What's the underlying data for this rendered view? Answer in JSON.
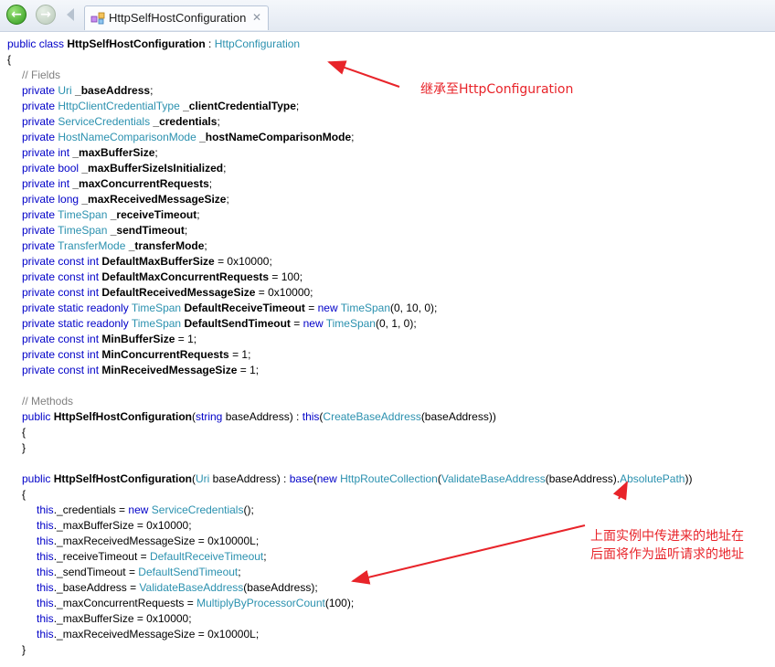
{
  "tab": {
    "title": "HttpSelfHostConfiguration",
    "close_glyph": "✕",
    "icon": "class-icon"
  },
  "nav": {
    "back_icon": "back-arrow-icon",
    "forward_icon": "forward-arrow-icon"
  },
  "code_lines": [
    {
      "indent": 0,
      "parts": [
        [
          "kw",
          "public class "
        ],
        [
          "b",
          "HttpSelfHostConfiguration"
        ],
        [
          "",
          " : "
        ],
        [
          "tp",
          "HttpConfiguration"
        ]
      ]
    },
    {
      "indent": 0,
      "parts": [
        [
          "",
          "{"
        ]
      ]
    },
    {
      "indent": 1,
      "parts": [
        [
          "cm",
          "// Fields"
        ]
      ]
    },
    {
      "indent": 1,
      "parts": [
        [
          "kw",
          "private "
        ],
        [
          "tp",
          "Uri "
        ],
        [
          "b",
          "_baseAddress"
        ],
        [
          "",
          ";"
        ]
      ]
    },
    {
      "indent": 1,
      "parts": [
        [
          "kw",
          "private "
        ],
        [
          "tp",
          "HttpClientCredentialType "
        ],
        [
          "b",
          "_clientCredentialType"
        ],
        [
          "",
          ";"
        ]
      ]
    },
    {
      "indent": 1,
      "parts": [
        [
          "kw",
          "private "
        ],
        [
          "tp",
          "ServiceCredentials "
        ],
        [
          "b",
          "_credentials"
        ],
        [
          "",
          ";"
        ]
      ]
    },
    {
      "indent": 1,
      "parts": [
        [
          "kw",
          "private "
        ],
        [
          "tp",
          "HostNameComparisonMode "
        ],
        [
          "b",
          "_hostNameComparisonMode"
        ],
        [
          "",
          ";"
        ]
      ]
    },
    {
      "indent": 1,
      "parts": [
        [
          "kw",
          "private int "
        ],
        [
          "b",
          "_maxBufferSize"
        ],
        [
          "",
          ";"
        ]
      ]
    },
    {
      "indent": 1,
      "parts": [
        [
          "kw",
          "private bool "
        ],
        [
          "b",
          "_maxBufferSizeIsInitialized"
        ],
        [
          "",
          ";"
        ]
      ]
    },
    {
      "indent": 1,
      "parts": [
        [
          "kw",
          "private int "
        ],
        [
          "b",
          "_maxConcurrentRequests"
        ],
        [
          "",
          ";"
        ]
      ]
    },
    {
      "indent": 1,
      "parts": [
        [
          "kw",
          "private long "
        ],
        [
          "b",
          "_maxReceivedMessageSize"
        ],
        [
          "",
          ";"
        ]
      ]
    },
    {
      "indent": 1,
      "parts": [
        [
          "kw",
          "private "
        ],
        [
          "tp",
          "TimeSpan "
        ],
        [
          "b",
          "_receiveTimeout"
        ],
        [
          "",
          ";"
        ]
      ]
    },
    {
      "indent": 1,
      "parts": [
        [
          "kw",
          "private "
        ],
        [
          "tp",
          "TimeSpan "
        ],
        [
          "b",
          "_sendTimeout"
        ],
        [
          "",
          ";"
        ]
      ]
    },
    {
      "indent": 1,
      "parts": [
        [
          "kw",
          "private "
        ],
        [
          "tp",
          "TransferMode "
        ],
        [
          "b",
          "_transferMode"
        ],
        [
          "",
          ";"
        ]
      ]
    },
    {
      "indent": 1,
      "parts": [
        [
          "kw",
          "private const int "
        ],
        [
          "b",
          "DefaultMaxBufferSize"
        ],
        [
          "",
          " = 0x10000;"
        ]
      ]
    },
    {
      "indent": 1,
      "parts": [
        [
          "kw",
          "private const int "
        ],
        [
          "b",
          "DefaultMaxConcurrentRequests"
        ],
        [
          "",
          " = 100;"
        ]
      ]
    },
    {
      "indent": 1,
      "parts": [
        [
          "kw",
          "private const int "
        ],
        [
          "b",
          "DefaultReceivedMessageSize"
        ],
        [
          "",
          " = 0x10000;"
        ]
      ]
    },
    {
      "indent": 1,
      "parts": [
        [
          "kw",
          "private static readonly "
        ],
        [
          "tp",
          "TimeSpan "
        ],
        [
          "b",
          "DefaultReceiveTimeout"
        ],
        [
          "",
          " = "
        ],
        [
          "kw",
          "new "
        ],
        [
          "tp",
          "TimeSpan"
        ],
        [
          "",
          "(0, 10, 0);"
        ]
      ]
    },
    {
      "indent": 1,
      "parts": [
        [
          "kw",
          "private static readonly "
        ],
        [
          "tp",
          "TimeSpan "
        ],
        [
          "b",
          "DefaultSendTimeout"
        ],
        [
          "",
          " = "
        ],
        [
          "kw",
          "new "
        ],
        [
          "tp",
          "TimeSpan"
        ],
        [
          "",
          "(0, 1, 0);"
        ]
      ]
    },
    {
      "indent": 1,
      "parts": [
        [
          "kw",
          "private const int "
        ],
        [
          "b",
          "MinBufferSize"
        ],
        [
          "",
          " = 1;"
        ]
      ]
    },
    {
      "indent": 1,
      "parts": [
        [
          "kw",
          "private const int "
        ],
        [
          "b",
          "MinConcurrentRequests"
        ],
        [
          "",
          " = 1;"
        ]
      ]
    },
    {
      "indent": 1,
      "parts": [
        [
          "kw",
          "private const int "
        ],
        [
          "b",
          "MinReceivedMessageSize"
        ],
        [
          "",
          " = 1;"
        ]
      ]
    },
    {
      "indent": 1,
      "parts": []
    },
    {
      "indent": 1,
      "parts": [
        [
          "cm",
          "// Methods"
        ]
      ]
    },
    {
      "indent": 1,
      "parts": [
        [
          "kw",
          "public "
        ],
        [
          "b",
          "HttpSelfHostConfiguration"
        ],
        [
          "",
          "("
        ],
        [
          "kw",
          "string "
        ],
        [
          "",
          "baseAddress) : "
        ],
        [
          "kw",
          "this"
        ],
        [
          "",
          "("
        ],
        [
          "tp",
          "CreateBaseAddress"
        ],
        [
          "",
          "(baseAddress))"
        ]
      ]
    },
    {
      "indent": 1,
      "parts": [
        [
          "",
          "{"
        ]
      ]
    },
    {
      "indent": 1,
      "parts": [
        [
          "",
          "}"
        ]
      ]
    },
    {
      "indent": 1,
      "parts": []
    },
    {
      "indent": 1,
      "parts": [
        [
          "kw",
          "public "
        ],
        [
          "b",
          "HttpSelfHostConfiguration"
        ],
        [
          "",
          "("
        ],
        [
          "tp",
          "Uri "
        ],
        [
          "",
          "baseAddress) : "
        ],
        [
          "kw",
          "base"
        ],
        [
          "",
          "("
        ],
        [
          "kw",
          "new "
        ],
        [
          "tp",
          "HttpRouteCollection"
        ],
        [
          "",
          "("
        ],
        [
          "tp",
          "ValidateBaseAddress"
        ],
        [
          "",
          "(baseAddress)."
        ],
        [
          "tp",
          "AbsolutePath"
        ],
        [
          "",
          "))"
        ]
      ]
    },
    {
      "indent": 1,
      "parts": [
        [
          "",
          "{"
        ]
      ]
    },
    {
      "indent": 2,
      "parts": [
        [
          "kw",
          "this"
        ],
        [
          "",
          "._credentials = "
        ],
        [
          "kw",
          "new "
        ],
        [
          "tp",
          "ServiceCredentials"
        ],
        [
          "",
          "();"
        ]
      ]
    },
    {
      "indent": 2,
      "parts": [
        [
          "kw",
          "this"
        ],
        [
          "",
          "._maxBufferSize = 0x10000;"
        ]
      ]
    },
    {
      "indent": 2,
      "parts": [
        [
          "kw",
          "this"
        ],
        [
          "",
          "._maxReceivedMessageSize = 0x10000L;"
        ]
      ]
    },
    {
      "indent": 2,
      "parts": [
        [
          "kw",
          "this"
        ],
        [
          "",
          "._receiveTimeout = "
        ],
        [
          "tp",
          "DefaultReceiveTimeout"
        ],
        [
          "",
          ";"
        ]
      ]
    },
    {
      "indent": 2,
      "parts": [
        [
          "kw",
          "this"
        ],
        [
          "",
          "._sendTimeout = "
        ],
        [
          "tp",
          "DefaultSendTimeout"
        ],
        [
          "",
          ";"
        ]
      ]
    },
    {
      "indent": 2,
      "parts": [
        [
          "kw",
          "this"
        ],
        [
          "",
          "._baseAddress = "
        ],
        [
          "tp",
          "ValidateBaseAddress"
        ],
        [
          "",
          "(baseAddress);"
        ]
      ]
    },
    {
      "indent": 2,
      "parts": [
        [
          "kw",
          "this"
        ],
        [
          "",
          "._maxConcurrentRequests = "
        ],
        [
          "tp",
          "MultiplyByProcessorCount"
        ],
        [
          "",
          "(100);"
        ]
      ]
    },
    {
      "indent": 2,
      "parts": [
        [
          "kw",
          "this"
        ],
        [
          "",
          "._maxBufferSize = 0x10000;"
        ]
      ]
    },
    {
      "indent": 2,
      "parts": [
        [
          "kw",
          "this"
        ],
        [
          "",
          "._maxReceivedMessageSize = 0x10000L;"
        ]
      ]
    },
    {
      "indent": 1,
      "parts": [
        [
          "",
          "}"
        ]
      ]
    }
  ],
  "annotations": {
    "inherit_note": "继承至HttpConfiguration",
    "address_note_line1": "上面实例中传进来的地址在",
    "address_note_line2": "后面将作为监听请求的地址"
  },
  "colors": {
    "keyword": "#0000c8",
    "type": "#2b91af",
    "comment": "#808080",
    "annotation": "#e8242a"
  }
}
